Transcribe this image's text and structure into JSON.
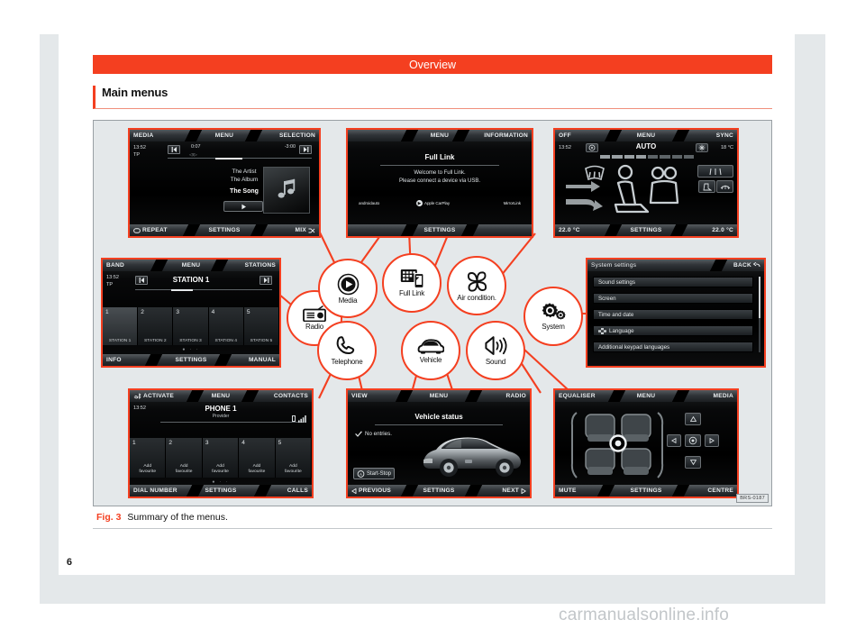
{
  "page": {
    "chapter": "Overview",
    "section_title": "Main menus",
    "page_number": "6",
    "watermark": "carmanualsonline.info",
    "figure_code": "BRS-0187",
    "caption_label": "Fig. 3",
    "caption_text": "Summary of the menus.",
    "accent_color": "#f43f20",
    "background_color": "#e4e8ea"
  },
  "hub": {
    "nodes": [
      {
        "id": "radio",
        "label": "Radio",
        "icon": "radio-icon"
      },
      {
        "id": "media",
        "label": "Media",
        "icon": "media-play-icon"
      },
      {
        "id": "fulllink",
        "label": "Full Link",
        "icon": "full-link-icon"
      },
      {
        "id": "aircon",
        "label": "Air condition.",
        "icon": "fan-icon"
      },
      {
        "id": "system",
        "label": "System",
        "icon": "gears-icon"
      },
      {
        "id": "telephone",
        "label": "Telephone",
        "icon": "handset-icon"
      },
      {
        "id": "vehicle",
        "label": "Vehicle",
        "icon": "car-icon"
      },
      {
        "id": "sound",
        "label": "Sound",
        "icon": "speaker-icon"
      }
    ]
  },
  "screens": {
    "media": {
      "top": {
        "left": "MEDIA",
        "center": "MENU",
        "right": "SELECTION"
      },
      "bottom": {
        "left": "REPEAT",
        "center": "SETTINGS",
        "right": "MIX"
      },
      "clock": "13:52",
      "tp": "TP",
      "elapsed": "0:07",
      "remaining": "-3:00",
      "artist": "The Artist",
      "album": "The Album",
      "song": "The Song",
      "prev_icon": "skip-back-icon",
      "next_icon": "skip-forward-icon",
      "play_icon": "play-icon",
      "art_icon": "music-note-icon",
      "repeat_icon": "repeat-icon",
      "mix_icon": "shuffle-icon"
    },
    "fulllink": {
      "top": {
        "left": "",
        "center": "MENU",
        "right": "INFORMATION"
      },
      "bottom": {
        "left": "",
        "center": "SETTINGS",
        "right": ""
      },
      "title": "Full Link",
      "line1": "Welcome to Full Link.",
      "line2": "Please connect a device via USB.",
      "providers": [
        {
          "name": "androidauto",
          "icon": "android-auto-icon"
        },
        {
          "name": "Apple CarPlay",
          "icon": "apple-carplay-icon"
        },
        {
          "name": "MirrorLink",
          "icon": "mirrorlink-icon"
        }
      ]
    },
    "aircon": {
      "top": {
        "left": "OFF",
        "center": "MENU",
        "right": "SYNC"
      },
      "bottom": {
        "left": "22.0 °C",
        "center": "SETTINGS",
        "right": "22.0 °C"
      },
      "clock": "13:52",
      "mode": "AUTO",
      "outside_temp": "18 °C",
      "left_icon": "defrost-front-icon",
      "right_icon": "snowflake-icon",
      "buttons": [
        {
          "icon": "rear-window-heating-icon"
        },
        {
          "icon": "seat-heating-icon"
        },
        {
          "icon": "rear-defrost-icon"
        }
      ],
      "blower_segments": 8,
      "blower_level": 4
    },
    "radio": {
      "top": {
        "left": "BAND",
        "center": "MENU",
        "right": "STATIONS"
      },
      "bottom": {
        "left": "INFO",
        "center": "SETTINGS",
        "right": "MANUAL"
      },
      "clock": "13:52",
      "tp": "TP",
      "station": "STATION 1",
      "prev_icon": "skip-back-icon",
      "next_icon": "skip-forward-icon",
      "presets": [
        {
          "num": "1",
          "name": "STATION 1"
        },
        {
          "num": "2",
          "name": "STATION 2"
        },
        {
          "num": "3",
          "name": "STATION 3"
        },
        {
          "num": "4",
          "name": "STATION 4"
        },
        {
          "num": "5",
          "name": "STATION 5"
        }
      ],
      "pager": "● · ·"
    },
    "system": {
      "title": "System settings",
      "back_label": "BACK",
      "back_icon": "back-arrow-icon",
      "rows": [
        {
          "label": "Sound settings",
          "icon": ""
        },
        {
          "label": "Screen",
          "icon": ""
        },
        {
          "label": "Time and date",
          "icon": ""
        },
        {
          "label": "Language",
          "icon": "flag-icon"
        },
        {
          "label": "Additional keypad languages",
          "icon": ""
        }
      ]
    },
    "phone": {
      "top": {
        "left": "ACTIVATE",
        "center": "MENU",
        "right": "CONTACTS"
      },
      "bottom": {
        "left": "DIAL NUMBER",
        "center": "SETTINGS",
        "right": "CALLS"
      },
      "clock": "13:52",
      "device": "PHONE 1",
      "provider": "Provider",
      "activate_icon": "bluetooth-phone-icon",
      "battery_icon": "battery-icon",
      "signal_icon": "signal-bars-icon",
      "presets": [
        {
          "num": "1",
          "line1": "Add",
          "line2": "favourite"
        },
        {
          "num": "2",
          "line1": "Add",
          "line2": "favourite"
        },
        {
          "num": "3",
          "line1": "Add",
          "line2": "favourite"
        },
        {
          "num": "4",
          "line1": "Add",
          "line2": "favourite"
        },
        {
          "num": "5",
          "line1": "Add",
          "line2": "favourite"
        }
      ],
      "pager": "● · ·"
    },
    "vehicle": {
      "top": {
        "left": "VIEW",
        "center": "MENU",
        "right": "RADIO"
      },
      "bottom": {
        "left": "PREVIOUS",
        "center": "SETTINGS",
        "right": "NEXT"
      },
      "title": "Vehicle status",
      "status": "No entries.",
      "status_icon": "check-icon",
      "start_stop_label": "Start-Stop",
      "start_stop_icon": "start-stop-icon",
      "prev_icon": "triangle-left-icon",
      "next_icon": "triangle-right-icon",
      "car_icon": "car-photo"
    },
    "equaliser": {
      "top": {
        "left": "EQUALISER",
        "center": "MENU",
        "right": "MEDIA"
      },
      "bottom": {
        "left": "MUTE",
        "center": "SETTINGS",
        "right": "CENTRE"
      },
      "balance_icon": "balance-target-icon",
      "pad": {
        "up": "triangle-up-icon",
        "down": "triangle-down-icon",
        "left": "triangle-left-icon",
        "right": "triangle-right-icon",
        "center": "centre-icon"
      }
    }
  }
}
